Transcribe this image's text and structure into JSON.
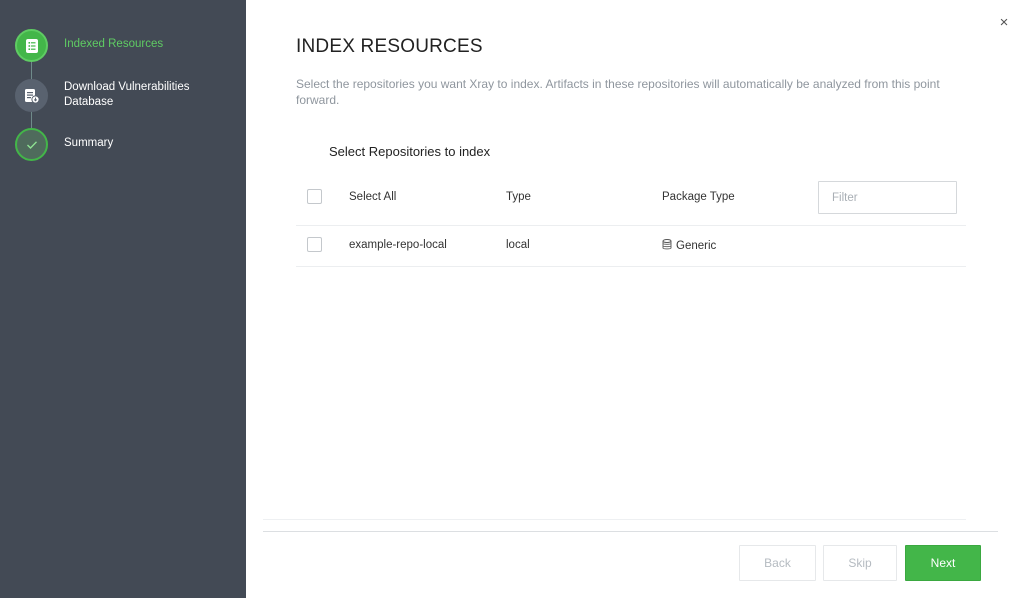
{
  "sidebar": {
    "steps": [
      {
        "label": "Indexed Resources",
        "state": "active",
        "icon": "list-document-icon"
      },
      {
        "label": "Download Vulnerabilities Database",
        "state": "pending",
        "icon": "database-document-icon"
      },
      {
        "label": "Summary",
        "state": "summary",
        "icon": "checkmark-icon"
      }
    ]
  },
  "dialog": {
    "close_label": "×",
    "title": "INDEX RESOURCES",
    "description": "Select the repositories you want Xray to index. Artifacts in these repositories will automatically be analyzed from this point forward."
  },
  "repositories": {
    "section_title": "Select Repositories to index",
    "header": {
      "select_all": "Select All",
      "type": "Type",
      "package_type": "Package Type"
    },
    "filter_placeholder": "Filter",
    "rows": [
      {
        "name": "example-repo-local",
        "type": "local",
        "package_type": "Generic",
        "package_icon": "database-icon"
      }
    ]
  },
  "footer": {
    "back_label": "Back",
    "skip_label": "Skip",
    "next_label": "Next"
  },
  "colors": {
    "sidebar_bg": "#434a55",
    "accent_green": "#43b649",
    "active_text": "#5fcc63"
  }
}
